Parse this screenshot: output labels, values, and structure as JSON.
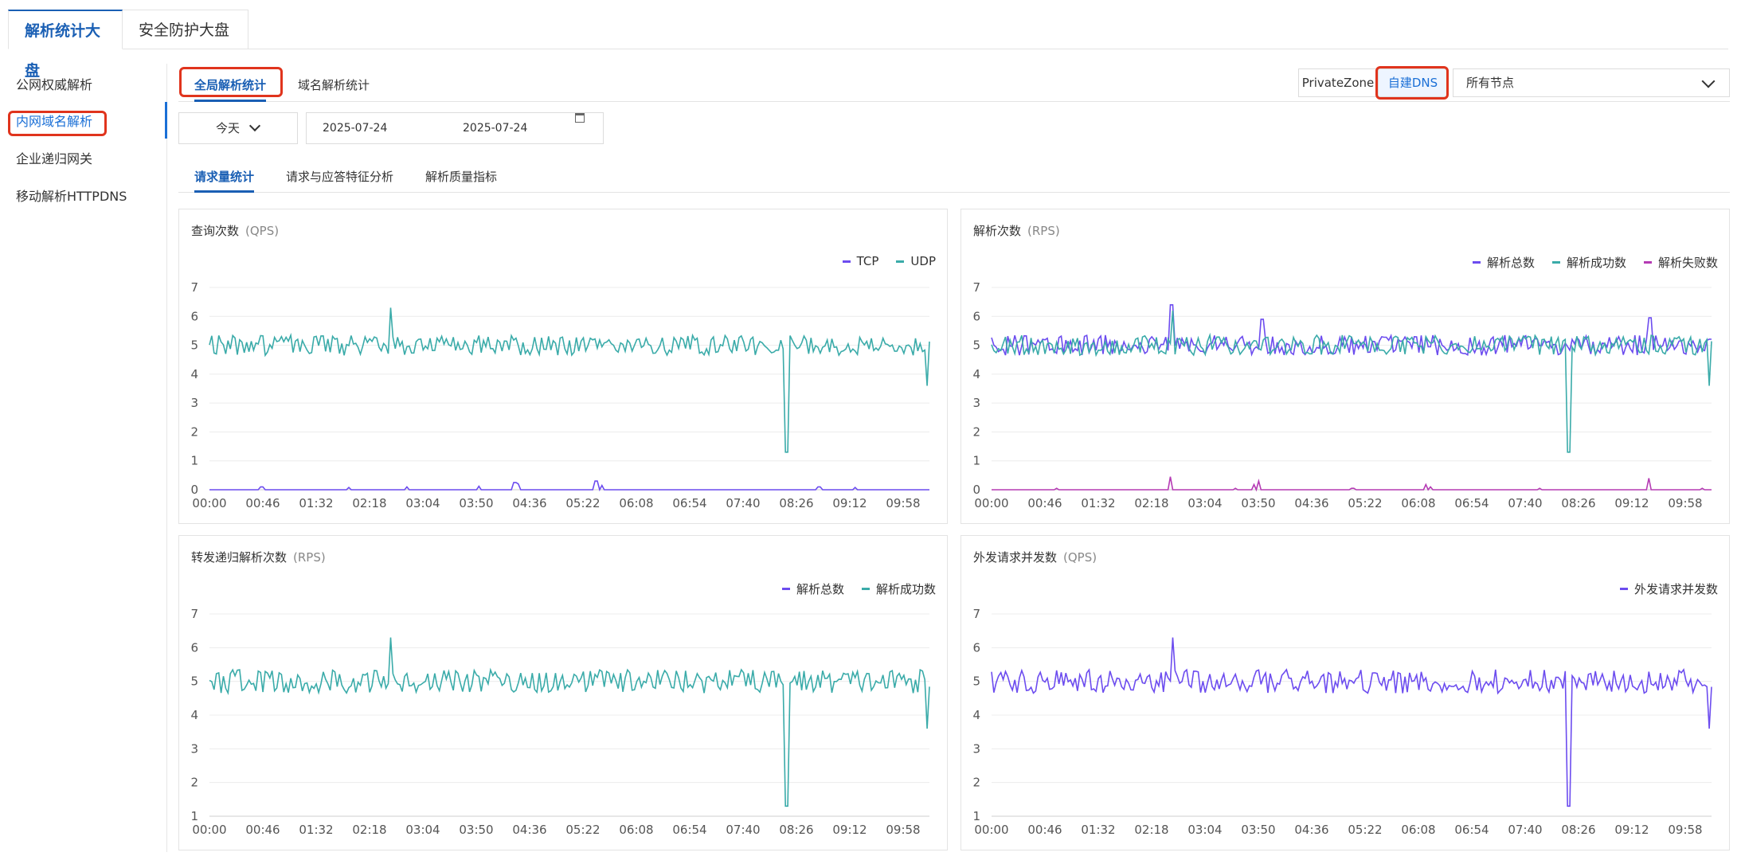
{
  "top_tabs": [
    "解析统计大盘",
    "安全防护大盘"
  ],
  "sidebar": {
    "items": [
      {
        "label": "公网权威解析"
      },
      {
        "label": "内网域名解析"
      },
      {
        "label": "企业递归网关"
      },
      {
        "label": "移动解析HTTPDNS"
      }
    ],
    "active_index": 1
  },
  "sub_tabs": [
    "全局解析统计",
    "域名解析统计"
  ],
  "zone_toggle": {
    "options": [
      "PrivateZone",
      "自建DNS"
    ],
    "active_index": 1
  },
  "node_select": {
    "value": "所有节点"
  },
  "date_filter": {
    "period": "今天",
    "start": "2025-07-24",
    "end": "2025-07-24"
  },
  "metric_tabs": [
    "请求量统计",
    "请求与应答特征分析",
    "解析质量指标"
  ],
  "colors": {
    "accent": "#1a5fb4",
    "highlight_box": "#e0341d",
    "teal": "#3aaba9",
    "purple": "#6c4cef",
    "magenta": "#b53bb4"
  },
  "chart_data": [
    {
      "type": "line",
      "title": "查询次数",
      "unit": "(QPS)",
      "ylim": [
        0,
        7
      ],
      "y_ticks": [
        "0",
        "1",
        "2",
        "3",
        "4",
        "5",
        "6",
        "7"
      ],
      "x_ticks": [
        "00:00",
        "00:46",
        "01:32",
        "02:18",
        "03:04",
        "03:50",
        "04:36",
        "05:22",
        "06:08",
        "06:54",
        "07:40",
        "08:26",
        "09:12",
        "09:58"
      ],
      "x_range_minutes": [
        0,
        620
      ],
      "series": [
        {
          "name": "TCP",
          "color": "#6c4cef",
          "baseline": 0,
          "spikes": [
            [
              45,
              0.1
            ],
            [
              120,
              0.08
            ],
            [
              170,
              0.1
            ],
            [
              232,
              0.12
            ],
            [
              263,
              0.25
            ],
            [
              266,
              0.2
            ],
            [
              333,
              0.3
            ],
            [
              338,
              0.15
            ],
            [
              525,
              0.1
            ],
            [
              556,
              0.08
            ]
          ]
        },
        {
          "name": "UDP",
          "color": "#3aaba9",
          "baseline": 5.0,
          "noise": 0.35,
          "spikes": [
            [
              156,
              6.3
            ],
            [
              497,
              1.3
            ],
            [
              618,
              3.6
            ]
          ]
        }
      ]
    },
    {
      "type": "line",
      "title": "解析次数",
      "unit": "(RPS)",
      "ylim": [
        0,
        7
      ],
      "y_ticks": [
        "0",
        "1",
        "2",
        "3",
        "4",
        "5",
        "6",
        "7"
      ],
      "x_ticks": [
        "00:00",
        "00:46",
        "01:32",
        "02:18",
        "03:04",
        "03:50",
        "04:36",
        "05:22",
        "06:08",
        "06:54",
        "07:40",
        "08:26",
        "09:12",
        "09:58"
      ],
      "x_range_minutes": [
        0,
        620
      ],
      "series": [
        {
          "name": "解析总数",
          "color": "#6c4cef",
          "baseline": 5.0,
          "noise": 0.35,
          "spikes": [
            [
              155,
              6.4
            ],
            [
              233,
              5.9
            ],
            [
              567,
              5.95
            ]
          ]
        },
        {
          "name": "解析成功数",
          "color": "#3aaba9",
          "baseline": 5.0,
          "noise": 0.35,
          "spikes": [
            [
              156,
              6.2
            ],
            [
              497,
              1.3
            ],
            [
              618,
              3.6
            ]
          ]
        },
        {
          "name": "解析失败数",
          "color": "#b53bb4",
          "baseline": 0,
          "spikes": [
            [
              56,
              0.05
            ],
            [
              154,
              0.45
            ],
            [
              210,
              0.05
            ],
            [
              226,
              0.18
            ],
            [
              230,
              0.3
            ],
            [
              311,
              0.05
            ],
            [
              374,
              0.18
            ],
            [
              378,
              0.1
            ],
            [
              472,
              0.05
            ],
            [
              566,
              0.4
            ],
            [
              612,
              0.05
            ]
          ]
        }
      ]
    },
    {
      "type": "line",
      "title": "转发递归解析次数",
      "unit": "(RPS)",
      "ylim": [
        1,
        7
      ],
      "y_ticks": [
        "1",
        "2",
        "3",
        "4",
        "5",
        "6",
        "7"
      ],
      "x_ticks": [
        "00:00",
        "00:46",
        "01:32",
        "02:18",
        "03:04",
        "03:50",
        "04:36",
        "05:22",
        "06:08",
        "06:54",
        "07:40",
        "08:26",
        "09:12",
        "09:58"
      ],
      "x_range_minutes": [
        0,
        620
      ],
      "series": [
        {
          "name": "解析总数",
          "color": "#6c4cef",
          "baseline": 5.0,
          "noise": 0.35,
          "spikes": [],
          "hidden": true
        },
        {
          "name": "解析成功数",
          "color": "#3aaba9",
          "baseline": 5.0,
          "noise": 0.35,
          "spikes": [
            [
              156,
              6.3
            ],
            [
              497,
              1.3
            ],
            [
              618,
              3.6
            ]
          ]
        }
      ]
    },
    {
      "type": "line",
      "title": "外发请求并发数",
      "unit": "(QPS)",
      "ylim": [
        1,
        7
      ],
      "y_ticks": [
        "1",
        "2",
        "3",
        "4",
        "5",
        "6",
        "7"
      ],
      "x_ticks": [
        "00:00",
        "00:46",
        "01:32",
        "02:18",
        "03:04",
        "03:50",
        "04:36",
        "05:22",
        "06:08",
        "06:54",
        "07:40",
        "08:26",
        "09:12",
        "09:58"
      ],
      "x_range_minutes": [
        0,
        620
      ],
      "series": [
        {
          "name": "外发请求并发数",
          "color": "#6c4cef",
          "baseline": 5.0,
          "noise": 0.35,
          "spikes": [
            [
              156,
              6.3
            ],
            [
              497,
              1.3
            ],
            [
              618,
              3.6
            ]
          ]
        }
      ]
    }
  ]
}
